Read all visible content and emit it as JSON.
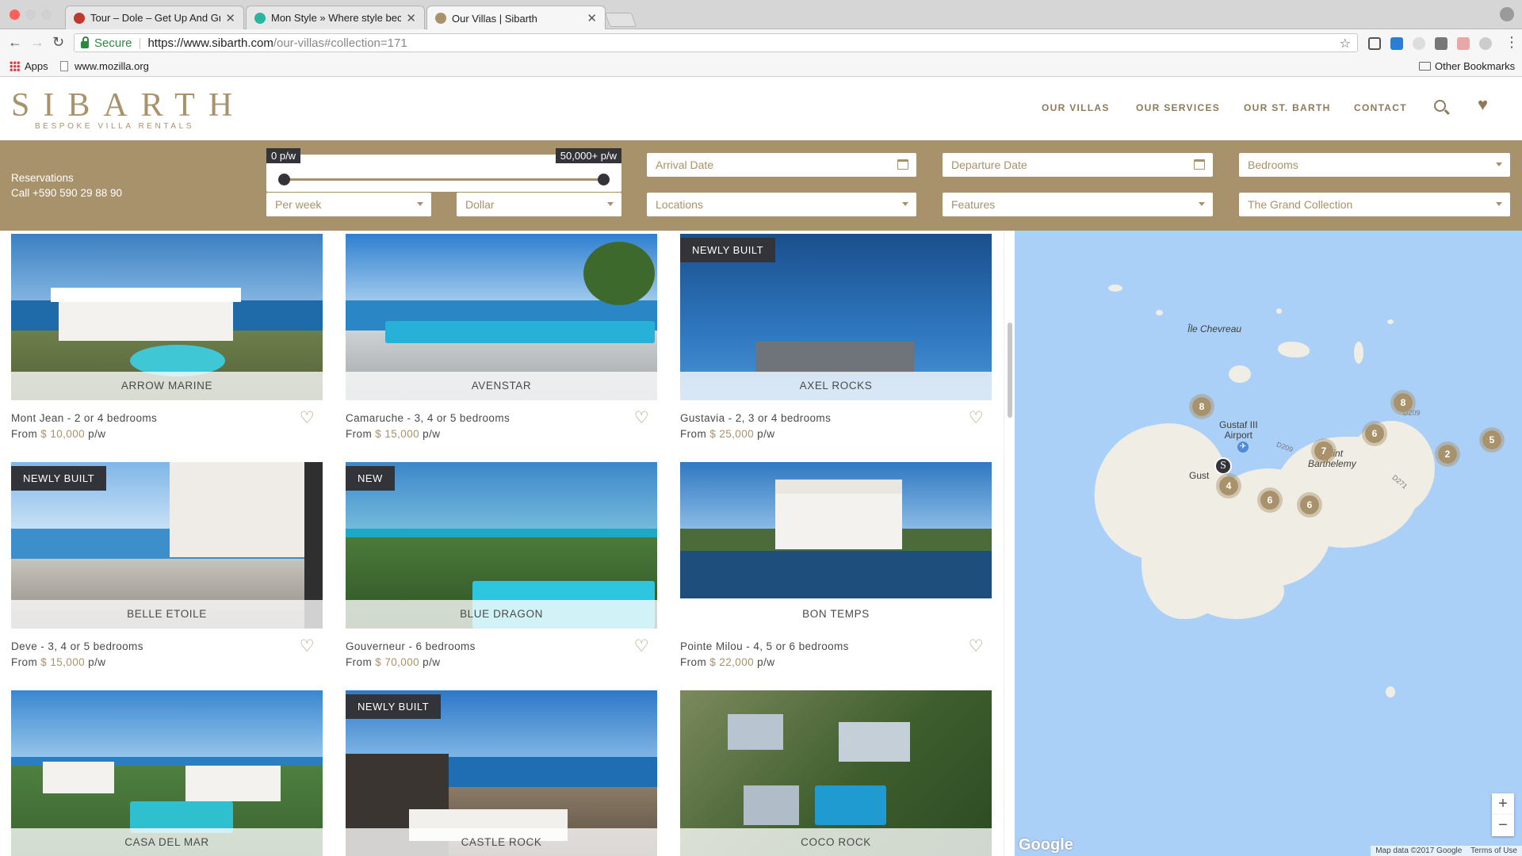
{
  "browser": {
    "tabs": [
      {
        "title": "Tour – Dole – Get Up And Grow",
        "favicon_color": "#c0392b",
        "active": false
      },
      {
        "title": "Mon Style » Where style beco",
        "favicon_color": "#2bb5a0",
        "active": false
      },
      {
        "title": "Our Villas | Sibarth",
        "favicon_color": "#a8926b",
        "active": true
      }
    ],
    "security_label": "Secure",
    "url_host": "https://www.sibarth.com",
    "url_path": "/our-villas#collection=171",
    "bookmarks": {
      "apps": "Apps",
      "mozilla": "www.mozilla.org",
      "other": "Other Bookmarks"
    }
  },
  "site": {
    "logo": "SIBARTH",
    "tagline": "BESPOKE VILLA RENTALS",
    "nav": [
      "OUR VILLAS",
      "OUR SERVICES",
      "OUR ST. BARTH",
      "CONTACT"
    ],
    "brand_color": "#a8926b",
    "dark_color": "#32343a"
  },
  "filters": {
    "reservations_title": "Reservations",
    "reservations_phone": "Call +590 590 29 88 90",
    "price_min": "0 p/w",
    "price_max": "50,000+ p/w",
    "arrival_placeholder": "Arrival Date",
    "departure_placeholder": "Departure Date",
    "bedrooms": "Bedrooms",
    "period": "Per week",
    "currency": "Dollar",
    "locations": "Locations",
    "features": "Features",
    "collection": "The Grand Collection"
  },
  "villas": [
    {
      "name": "ARROW MARINE",
      "location": "Mont Jean",
      "bedrooms": "2 or 4 bedrooms",
      "price": "$ 10,000",
      "badge": ""
    },
    {
      "name": "AVENSTAR",
      "location": "Camaruche",
      "bedrooms": "3, 4 or 5 bedrooms",
      "price": "$ 15,000",
      "badge": ""
    },
    {
      "name": "AXEL ROCKS",
      "location": "Gustavia",
      "bedrooms": "2, 3 or 4 bedrooms",
      "price": "$ 25,000",
      "badge": "NEWLY BUILT"
    },
    {
      "name": "BELLE ETOILE",
      "location": "Deve",
      "bedrooms": "3, 4 or 5 bedrooms",
      "price": "$ 15,000",
      "badge": "NEWLY BUILT"
    },
    {
      "name": "BLUE DRAGON",
      "location": "Gouverneur",
      "bedrooms": "6 bedrooms",
      "price": "$ 70,000",
      "badge": "NEW"
    },
    {
      "name": "BON TEMPS",
      "location": "Pointe Milou",
      "bedrooms": "4, 5 or 6 bedrooms",
      "price": "$ 22,000",
      "badge": ""
    },
    {
      "name": "CASA DEL MAR",
      "location": "",
      "bedrooms": "",
      "price": "",
      "badge": ""
    },
    {
      "name": "CASTLE ROCK",
      "location": "",
      "bedrooms": "",
      "price": "",
      "badge": "NEWLY BUILT"
    },
    {
      "name": "COCO ROCK",
      "location": "",
      "bedrooms": "",
      "price": "",
      "badge": ""
    }
  ],
  "price_prefix": "From",
  "price_suffix": "p/w",
  "location_separator": "-",
  "map": {
    "labels": {
      "chevreau": "Île Chevreau",
      "airport": "Gustaf III\nAirport",
      "saint": "Saint\nBarthelemy",
      "gust": "Gust"
    },
    "clusters": [
      "8",
      "8",
      "6",
      "7",
      "2",
      "5",
      "4",
      "6",
      "6"
    ],
    "roads": [
      "D209",
      "D209",
      "D271"
    ],
    "google": "Google",
    "map_data": "Map data ©2017 Google",
    "terms": "Terms of Use",
    "zoom_in": "+",
    "zoom_out": "−"
  }
}
